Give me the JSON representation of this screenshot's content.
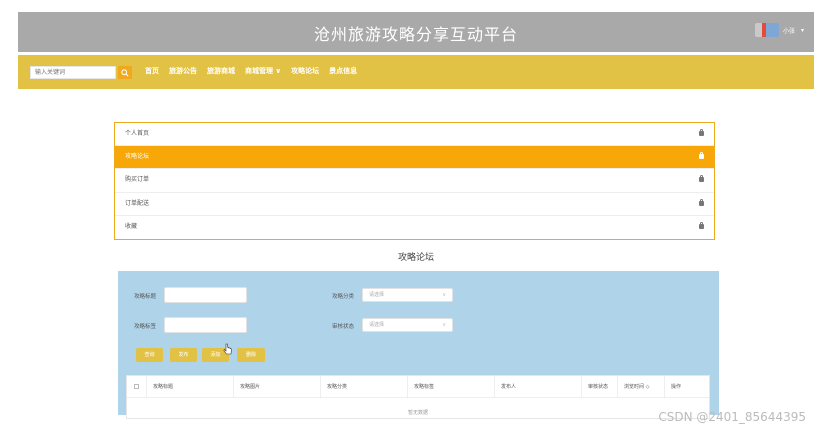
{
  "header": {
    "site_title": "沧州旅游攻略分享互动平台",
    "user_name": "小张",
    "user_caret": "▾"
  },
  "navbar": {
    "search_placeholder": "输入关键词",
    "items": [
      "首页",
      "旅游公告",
      "旅游商城",
      "商城管理 ∨",
      "攻略论坛",
      "景点信息"
    ]
  },
  "menu": {
    "items": [
      {
        "label": "个人首页",
        "active": false
      },
      {
        "label": "攻略论坛",
        "active": true
      },
      {
        "label": "购买订单",
        "active": false
      },
      {
        "label": "订单配送",
        "active": false
      },
      {
        "label": "收藏",
        "active": false
      }
    ]
  },
  "section_title": "攻略论坛",
  "filters": {
    "title_label": "攻略标题",
    "category_label": "攻略分类",
    "category_placeholder": "请选择",
    "tag_label": "攻略标签",
    "audit_label": "审核状态",
    "audit_placeholder": "请选择"
  },
  "buttons": {
    "query": "查询",
    "publish": "发布",
    "add": "添加",
    "delete": "删除"
  },
  "table": {
    "columns": [
      "攻略标题",
      "攻略图片",
      "攻略分类",
      "攻略标签",
      "发布人",
      "审核状态",
      "浏览时间 ◇",
      "操作"
    ],
    "empty_text": "暂无数据"
  },
  "watermark": "CSDN @2401_85644395"
}
